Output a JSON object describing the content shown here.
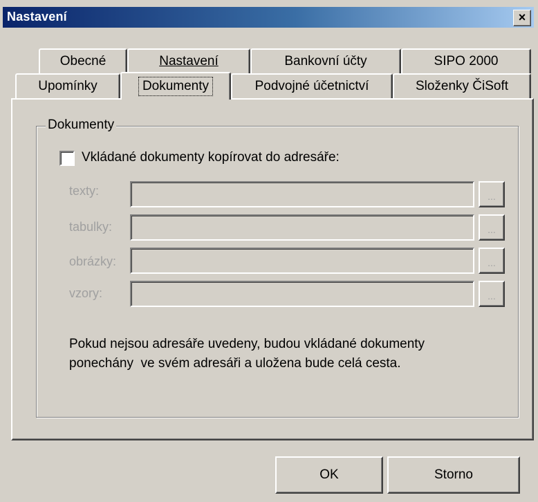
{
  "window": {
    "title": "Nastavení",
    "close_label": "×"
  },
  "tabs_row1": [
    {
      "label": "Obecné"
    },
    {
      "label": "Nastavení"
    },
    {
      "label": "Bankovní účty"
    },
    {
      "label": "SIPO 2000"
    }
  ],
  "tabs_row2": [
    {
      "label": "Upomínky"
    },
    {
      "label": "Dokumenty",
      "active": true
    },
    {
      "label": "Podvojné účetnictví"
    },
    {
      "label": "Složenky ČiSoft"
    }
  ],
  "group": {
    "label": "Dokumenty"
  },
  "copy_option": {
    "label": "Vkládané dokumenty kopírovat do adresáře:",
    "checked": false
  },
  "folders": [
    {
      "label": "texty:",
      "value": ""
    },
    {
      "label": "tabulky:",
      "value": ""
    },
    {
      "label": "obrázky:",
      "value": ""
    },
    {
      "label": "vzory:",
      "value": ""
    }
  ],
  "browse_label": "...",
  "info_text": {
    "line1": "Pokud nejsou adresáře uvedeny, budou vkládané dokumenty",
    "line2": "ponechány  ve svém adresáři a uložena bude celá cesta."
  },
  "buttons": {
    "ok": "OK",
    "cancel": "Storno"
  }
}
